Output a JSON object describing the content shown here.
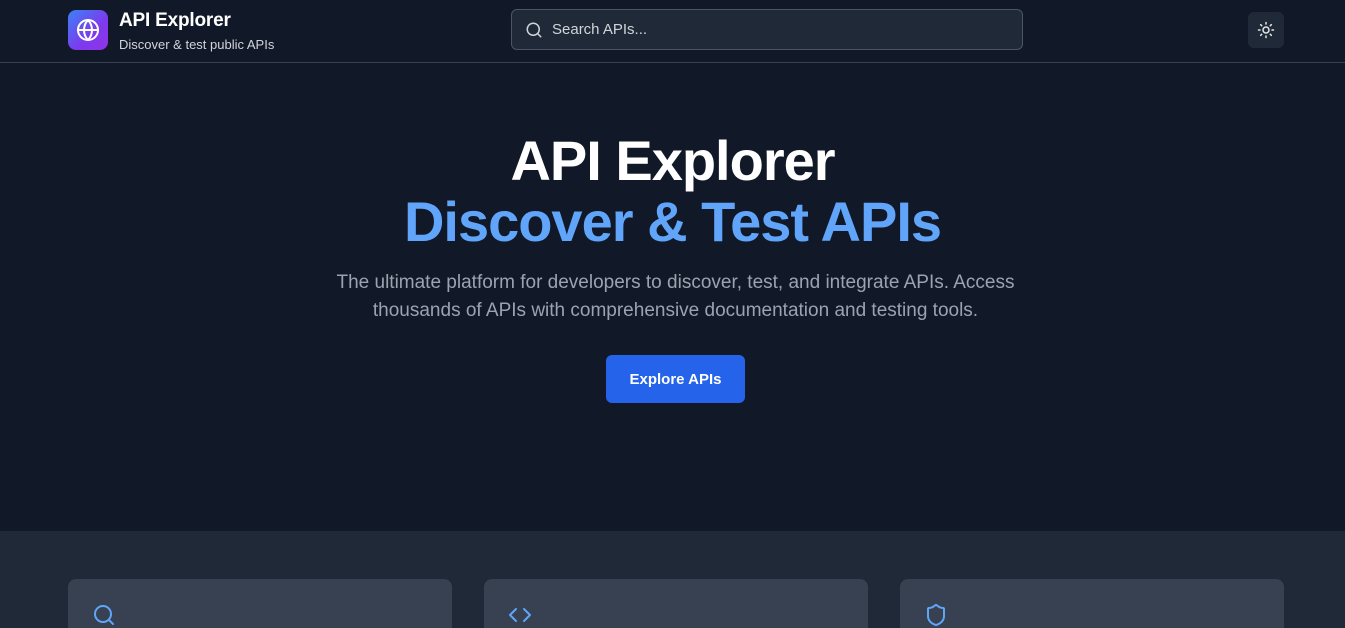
{
  "header": {
    "brand_title": "API Explorer",
    "brand_subtitle": "Discover & test public APIs",
    "logo_icon": "globe-icon",
    "search_placeholder": "Search APIs...",
    "theme_toggle_icon": "sun-icon"
  },
  "hero": {
    "title": "API Explorer",
    "subtitle": "Discover & Test APIs",
    "description": "The ultimate platform for developers to discover, test, and integrate APIs. Access thousands of APIs with comprehensive documentation and testing tools.",
    "cta_label": "Explore APIs"
  },
  "features": {
    "cards": [
      {
        "icon": "search-icon"
      },
      {
        "icon": "code-icon"
      },
      {
        "icon": "shield-icon"
      }
    ]
  },
  "colors": {
    "background": "#111827",
    "section_background": "#1f2937",
    "card_background": "#374151",
    "accent": "#2563eb",
    "accent_text": "#60a5fa",
    "logo_gradient_start": "#3b82f6",
    "logo_gradient_end": "#9333ea"
  }
}
